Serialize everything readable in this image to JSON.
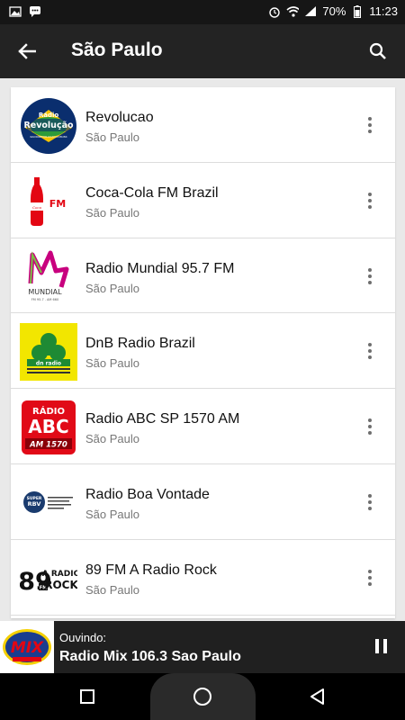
{
  "status_bar": {
    "battery": "70%",
    "time": "11:23",
    "icons": [
      "image-icon",
      "sms-icon",
      "alarm-icon",
      "wifi-icon",
      "signal-icon",
      "battery-icon"
    ]
  },
  "app_bar": {
    "title": "São Paulo",
    "back_icon": "arrow-back-icon",
    "search_icon": "search-icon"
  },
  "stations": [
    {
      "name": "Revolucao",
      "location": "São Paulo",
      "logo": "radio-revolucao-logo",
      "logo_text": "Rádio Revolução"
    },
    {
      "name": "Coca-Cola FM Brazil",
      "location": "São Paulo",
      "logo": "coca-cola-fm-logo",
      "logo_text": "FM"
    },
    {
      "name": "Radio Mundial 95.7 FM",
      "location": "São Paulo",
      "logo": "mundial-logo",
      "logo_text": "MUNDIAL"
    },
    {
      "name": "DnB Radio Brazil",
      "location": "São Paulo",
      "logo": "dnb-radio-logo",
      "logo_text": "dn radio"
    },
    {
      "name": "Radio ABC SP 1570 AM",
      "location": "São Paulo",
      "logo": "radio-abc-logo",
      "logo_text": "RÁDIO ABC AM 1570"
    },
    {
      "name": "Radio Boa Vontade",
      "location": "São Paulo",
      "logo": "super-rbv-logo",
      "logo_text": "SUPER RBV"
    },
    {
      "name": "89 FM A Radio Rock",
      "location": "São Paulo",
      "logo": "89fm-logo",
      "logo_text": "89 A RADIO ROCK"
    }
  ],
  "player": {
    "label": "Ouvindo:",
    "station": "Radio Mix 106.3 Sao Paulo",
    "logo": "mix-logo",
    "logo_text": "MIX"
  },
  "colors": {
    "app_bar": "#232323",
    "status_bar": "#161616",
    "player": "#202020",
    "list_bg": "#ffffff",
    "accent_red": "#e30613"
  }
}
